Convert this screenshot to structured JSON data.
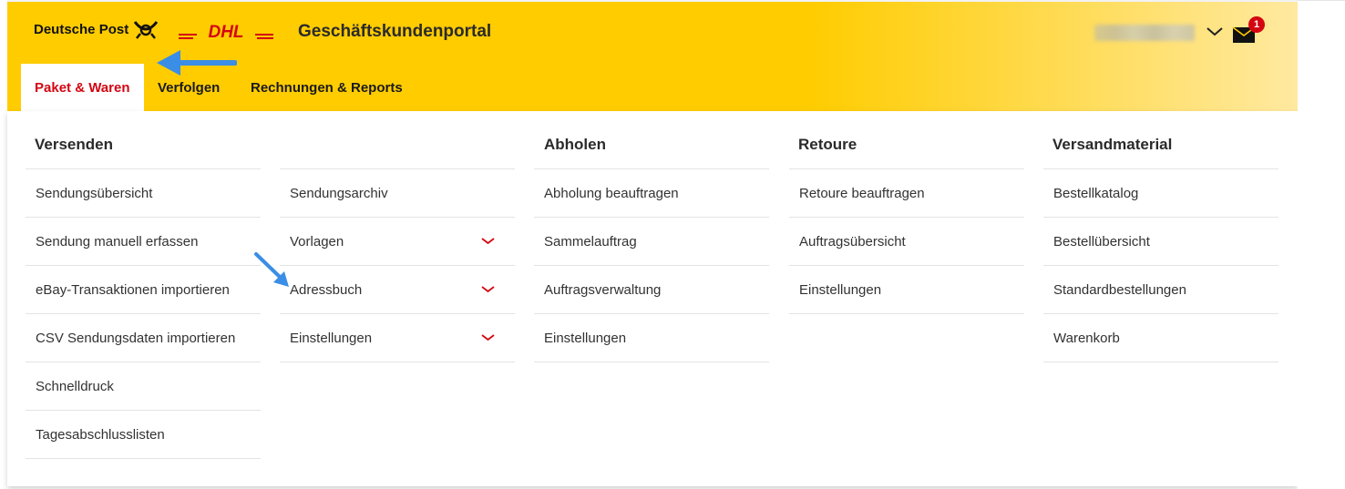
{
  "header": {
    "brand": "Deutsche Post",
    "dhl_logo_text": "DHL",
    "portal_title": "Geschäftskundenportal",
    "unread_count": "1",
    "colors": {
      "yellow": "#ffcc00",
      "red": "#d40511"
    }
  },
  "tabs": [
    {
      "label": "Paket & Waren",
      "active": true
    },
    {
      "label": "Verfolgen",
      "active": false
    },
    {
      "label": "Rechnungen & Reports",
      "active": false
    }
  ],
  "menu": {
    "versenden": {
      "title": "Versenden",
      "items": [
        "Sendungsübersicht",
        "Sendung manuell erfassen",
        "eBay-Transaktionen importieren",
        "CSV Sendungsdaten importieren",
        "Schnelldruck",
        "Tagesabschlusslisten"
      ]
    },
    "versenden2": {
      "items": [
        "Sendungsarchiv",
        "Vorlagen",
        "Adressbuch",
        "Einstellungen"
      ]
    },
    "abholen": {
      "title": "Abholen",
      "items": [
        "Abholung beauftragen",
        "Sammelauftrag",
        "Auftragsverwaltung",
        "Einstellungen"
      ]
    },
    "retoure": {
      "title": "Retoure",
      "items": [
        "Retoure beauftragen",
        "Auftragsübersicht",
        "Einstellungen"
      ]
    },
    "versandmaterial": {
      "title": "Versandmaterial",
      "items": [
        "Bestellkatalog",
        "Bestellübersicht",
        "Standardbestellungen",
        "Warenkorb"
      ]
    }
  },
  "icons": {
    "posthorn": "posthorn-icon",
    "user_menu": "chevron-down-icon",
    "mail": "mail-icon",
    "submenu": "chevron-down-icon",
    "annotation": "arrow-annotation-icon"
  }
}
